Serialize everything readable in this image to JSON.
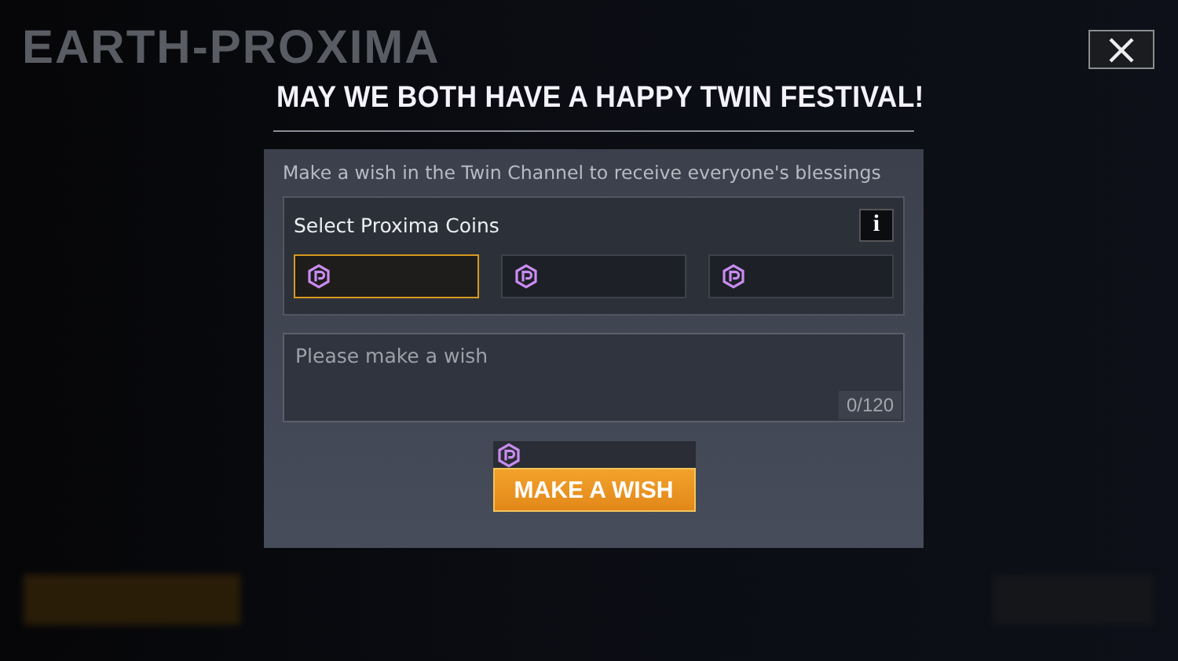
{
  "background": {
    "title": "EARTH-PROXIMA"
  },
  "dialog": {
    "title": "MAY WE BOTH HAVE A HAPPY TWIN FESTIVAL!",
    "message": "Make a wish in the Twin Channel to receive everyone's blessings",
    "coins": {
      "label": "Select Proxima Coins",
      "info": "i",
      "options": [
        {
          "selected": true
        },
        {
          "selected": false
        },
        {
          "selected": false
        }
      ]
    },
    "wish": {
      "placeholder": "Please make a wish",
      "counter": "0/120"
    },
    "button": "MAKE A WISH"
  }
}
